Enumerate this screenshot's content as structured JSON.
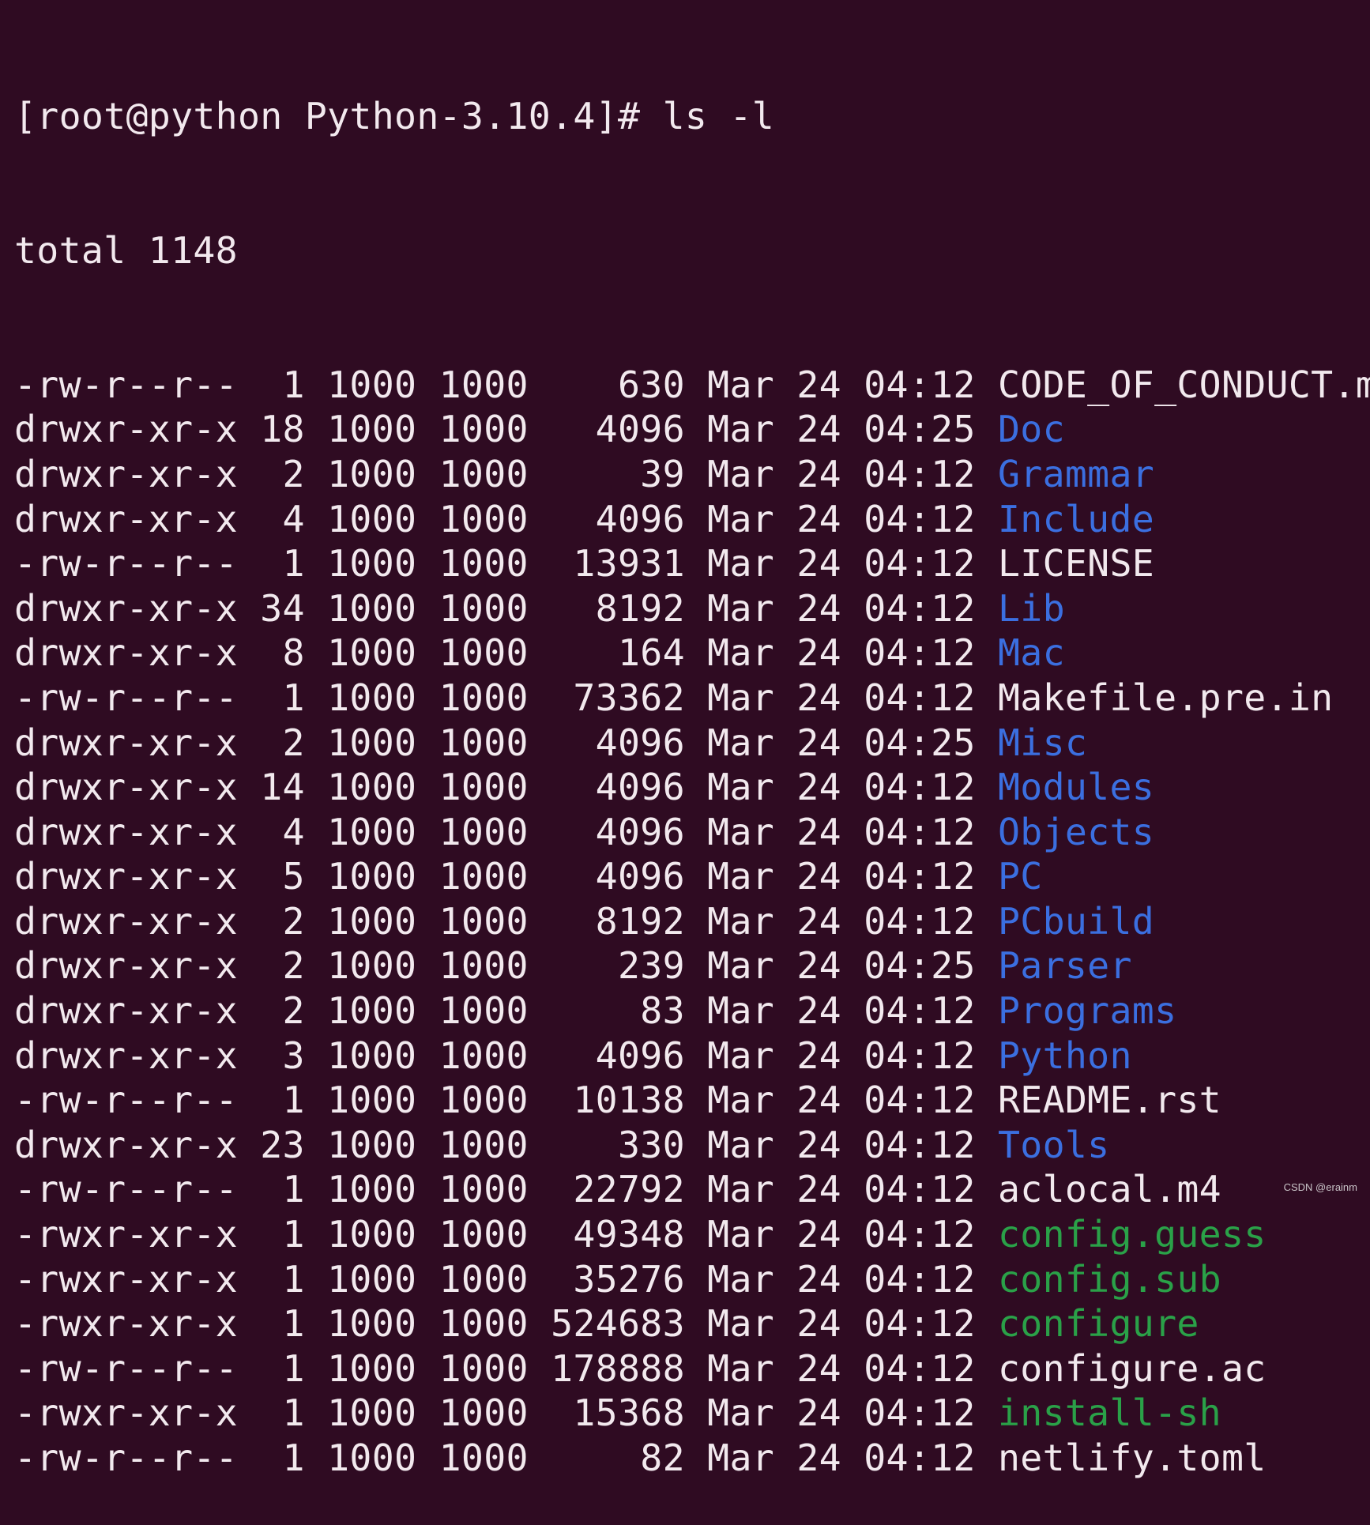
{
  "terminal": {
    "prompt": "[root@python Python-3.10.4]# ls -l",
    "total": "total 1148",
    "colors": {
      "background": "#2f0b22",
      "text": "#f2e9ee",
      "directory": "#3b6fe0",
      "executable": "#2aa148"
    },
    "rows": [
      {
        "perms": "-rw-r--r--",
        "links": "1",
        "owner": "1000",
        "group": "1000",
        "size": "630",
        "month": "Mar",
        "day": "24",
        "time": "04:12",
        "name": "CODE_OF_CONDUCT.md",
        "type": "file"
      },
      {
        "perms": "drwxr-xr-x",
        "links": "18",
        "owner": "1000",
        "group": "1000",
        "size": "4096",
        "month": "Mar",
        "day": "24",
        "time": "04:25",
        "name": "Doc",
        "type": "dir"
      },
      {
        "perms": "drwxr-xr-x",
        "links": "2",
        "owner": "1000",
        "group": "1000",
        "size": "39",
        "month": "Mar",
        "day": "24",
        "time": "04:12",
        "name": "Grammar",
        "type": "dir"
      },
      {
        "perms": "drwxr-xr-x",
        "links": "4",
        "owner": "1000",
        "group": "1000",
        "size": "4096",
        "month": "Mar",
        "day": "24",
        "time": "04:12",
        "name": "Include",
        "type": "dir"
      },
      {
        "perms": "-rw-r--r--",
        "links": "1",
        "owner": "1000",
        "group": "1000",
        "size": "13931",
        "month": "Mar",
        "day": "24",
        "time": "04:12",
        "name": "LICENSE",
        "type": "file"
      },
      {
        "perms": "drwxr-xr-x",
        "links": "34",
        "owner": "1000",
        "group": "1000",
        "size": "8192",
        "month": "Mar",
        "day": "24",
        "time": "04:12",
        "name": "Lib",
        "type": "dir"
      },
      {
        "perms": "drwxr-xr-x",
        "links": "8",
        "owner": "1000",
        "group": "1000",
        "size": "164",
        "month": "Mar",
        "day": "24",
        "time": "04:12",
        "name": "Mac",
        "type": "dir"
      },
      {
        "perms": "-rw-r--r--",
        "links": "1",
        "owner": "1000",
        "group": "1000",
        "size": "73362",
        "month": "Mar",
        "day": "24",
        "time": "04:12",
        "name": "Makefile.pre.in",
        "type": "file"
      },
      {
        "perms": "drwxr-xr-x",
        "links": "2",
        "owner": "1000",
        "group": "1000",
        "size": "4096",
        "month": "Mar",
        "day": "24",
        "time": "04:25",
        "name": "Misc",
        "type": "dir"
      },
      {
        "perms": "drwxr-xr-x",
        "links": "14",
        "owner": "1000",
        "group": "1000",
        "size": "4096",
        "month": "Mar",
        "day": "24",
        "time": "04:12",
        "name": "Modules",
        "type": "dir"
      },
      {
        "perms": "drwxr-xr-x",
        "links": "4",
        "owner": "1000",
        "group": "1000",
        "size": "4096",
        "month": "Mar",
        "day": "24",
        "time": "04:12",
        "name": "Objects",
        "type": "dir"
      },
      {
        "perms": "drwxr-xr-x",
        "links": "5",
        "owner": "1000",
        "group": "1000",
        "size": "4096",
        "month": "Mar",
        "day": "24",
        "time": "04:12",
        "name": "PC",
        "type": "dir"
      },
      {
        "perms": "drwxr-xr-x",
        "links": "2",
        "owner": "1000",
        "group": "1000",
        "size": "8192",
        "month": "Mar",
        "day": "24",
        "time": "04:12",
        "name": "PCbuild",
        "type": "dir"
      },
      {
        "perms": "drwxr-xr-x",
        "links": "2",
        "owner": "1000",
        "group": "1000",
        "size": "239",
        "month": "Mar",
        "day": "24",
        "time": "04:25",
        "name": "Parser",
        "type": "dir"
      },
      {
        "perms": "drwxr-xr-x",
        "links": "2",
        "owner": "1000",
        "group": "1000",
        "size": "83",
        "month": "Mar",
        "day": "24",
        "time": "04:12",
        "name": "Programs",
        "type": "dir"
      },
      {
        "perms": "drwxr-xr-x",
        "links": "3",
        "owner": "1000",
        "group": "1000",
        "size": "4096",
        "month": "Mar",
        "day": "24",
        "time": "04:12",
        "name": "Python",
        "type": "dir"
      },
      {
        "perms": "-rw-r--r--",
        "links": "1",
        "owner": "1000",
        "group": "1000",
        "size": "10138",
        "month": "Mar",
        "day": "24",
        "time": "04:12",
        "name": "README.rst",
        "type": "file"
      },
      {
        "perms": "drwxr-xr-x",
        "links": "23",
        "owner": "1000",
        "group": "1000",
        "size": "330",
        "month": "Mar",
        "day": "24",
        "time": "04:12",
        "name": "Tools",
        "type": "dir"
      },
      {
        "perms": "-rw-r--r--",
        "links": "1",
        "owner": "1000",
        "group": "1000",
        "size": "22792",
        "month": "Mar",
        "day": "24",
        "time": "04:12",
        "name": "aclocal.m4",
        "type": "file"
      },
      {
        "perms": "-rwxr-xr-x",
        "links": "1",
        "owner": "1000",
        "group": "1000",
        "size": "49348",
        "month": "Mar",
        "day": "24",
        "time": "04:12",
        "name": "config.guess",
        "type": "exec"
      },
      {
        "perms": "-rwxr-xr-x",
        "links": "1",
        "owner": "1000",
        "group": "1000",
        "size": "35276",
        "month": "Mar",
        "day": "24",
        "time": "04:12",
        "name": "config.sub",
        "type": "exec"
      },
      {
        "perms": "-rwxr-xr-x",
        "links": "1",
        "owner": "1000",
        "group": "1000",
        "size": "524683",
        "month": "Mar",
        "day": "24",
        "time": "04:12",
        "name": "configure",
        "type": "exec"
      },
      {
        "perms": "-rw-r--r--",
        "links": "1",
        "owner": "1000",
        "group": "1000",
        "size": "178888",
        "month": "Mar",
        "day": "24",
        "time": "04:12",
        "name": "configure.ac",
        "type": "file"
      },
      {
        "perms": "-rwxr-xr-x",
        "links": "1",
        "owner": "1000",
        "group": "1000",
        "size": "15368",
        "month": "Mar",
        "day": "24",
        "time": "04:12",
        "name": "install-sh",
        "type": "exec"
      },
      {
        "perms": "-rw-r--r--",
        "links": "1",
        "owner": "1000",
        "group": "1000",
        "size": "82",
        "month": "Mar",
        "day": "24",
        "time": "04:12",
        "name": "netlify.toml",
        "type": "file"
      }
    ]
  },
  "watermark": "CSDN @erainm"
}
